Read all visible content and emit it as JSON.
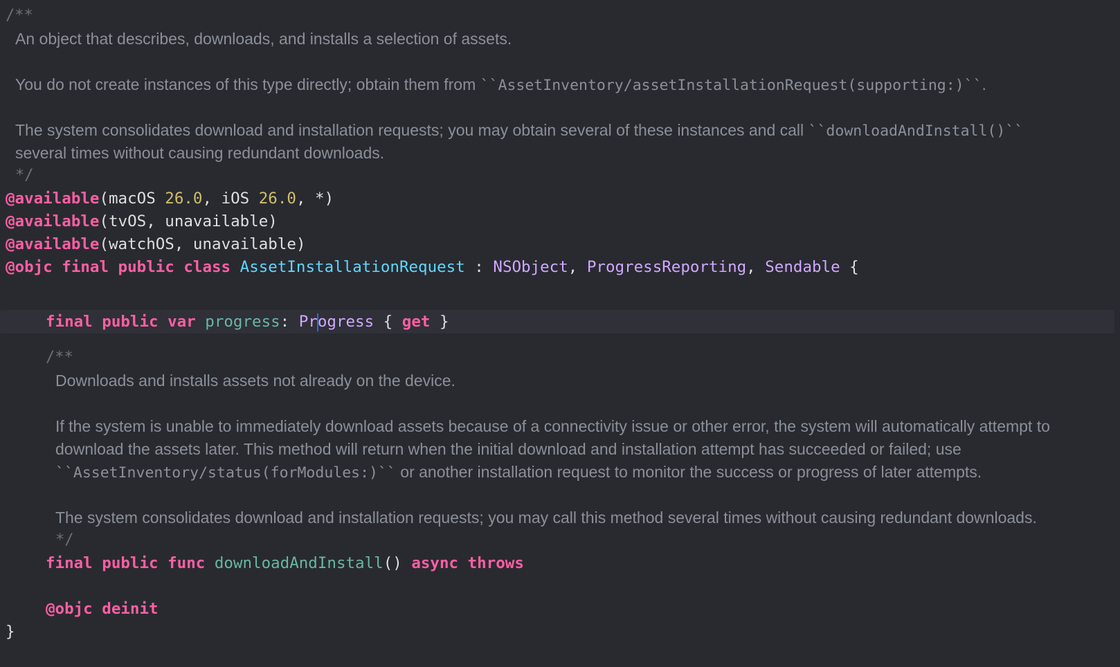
{
  "doc1": {
    "open": "/**",
    "p1": "An object that describes, downloads, and installs a selection of assets.",
    "p2_pre": "You do not create instances of this type directly; obtain them from ",
    "p2_code": "``AssetInventory/assetInstallationRequest(supporting:)``",
    "p2_post": ".",
    "p3_pre": "The system consolidates download and installation requests; you may obtain several of these instances and call ",
    "p3_code": "``downloadAndInstall()``",
    "p3_line2": "several times without causing redundant downloads.",
    "close": "*/"
  },
  "attrs": [
    {
      "at": "@available",
      "open": "(macOS ",
      "n1": "26.0",
      "mid": ", iOS ",
      "n2": "26.0",
      "end": ", *)"
    },
    {
      "at": "@available",
      "rest": "(tvOS, unavailable)"
    },
    {
      "at": "@available",
      "rest": "(watchOS, unavailable)"
    }
  ],
  "classdecl": {
    "kw": "@objc final public class",
    "name": "AssetInstallationRequest",
    "colon": " : ",
    "t1": "NSObject",
    "comma1": ", ",
    "t2": "ProgressReporting",
    "comma2": ", ",
    "t3": "Sendable",
    "brace": " {"
  },
  "prop": {
    "kw": "final public var",
    "name": "progress",
    "colon": ": ",
    "type_a": "Pr",
    "type_b": "ogress",
    "brace_open": " { ",
    "get": "get",
    "brace_close": " }"
  },
  "doc2": {
    "open": "/**",
    "p1": "Downloads and installs assets not already on the device.",
    "p2_l1": "If the system is unable to immediately download assets because of a connectivity issue or other error, the system will automatically attempt to",
    "p2_l2": "download the assets later. This method will return when the initial download and installation attempt has succeeded or failed; use",
    "p2_l3_code": "``AssetInventory/status(forModules:)``",
    "p2_l3_post": " or another installation request to monitor the success or progress of later attempts.",
    "p3": "The system consolidates download and installation requests; you may call this method several times without causing redundant downloads.",
    "close": "*/"
  },
  "func": {
    "kw": "final public func",
    "name": "downloadAndInstall",
    "parens": "()",
    "async": "async",
    "throws": "throws"
  },
  "deinit": {
    "at": "@objc",
    "kw": "deinit"
  },
  "closing_brace": "}",
  "colors": {
    "background": "#292a30",
    "keyword": "#fc5fa3",
    "number": "#d0bf69",
    "type_decl": "#5dd8ff",
    "type": "#d0a8ff",
    "property": "#67b7a4",
    "comment": "#8a9099",
    "plain": "#dfdfe0"
  }
}
